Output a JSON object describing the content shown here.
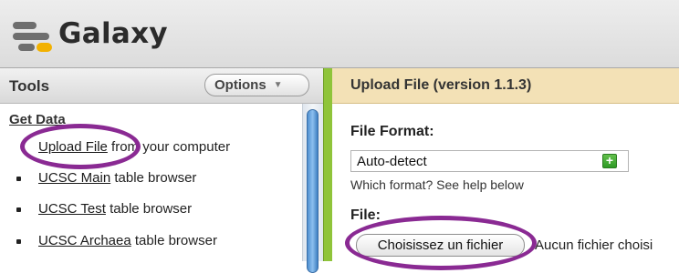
{
  "header": {
    "app_name": "Galaxy"
  },
  "tools_panel": {
    "title": "Tools",
    "options_label": "Options",
    "section_title": "Get Data",
    "items": [
      {
        "link": "Upload File",
        "text": "from your computer",
        "bullet": false
      },
      {
        "link": "UCSC Main",
        "text": "table browser",
        "bullet": true
      },
      {
        "link": "UCSC Test",
        "text": "table browser",
        "bullet": true
      },
      {
        "link": "UCSC Archaea",
        "text": "table browser",
        "bullet": true
      }
    ]
  },
  "form": {
    "title": "Upload File (version 1.1.3)",
    "file_format_label": "File Format:",
    "file_format_value": "Auto-detect",
    "file_format_help": "Which format? See help below",
    "file_label": "File:",
    "choose_file_label": "Choisissez un fichier",
    "no_file_text": "Aucun fichier choisi"
  },
  "colors": {
    "annotation": "#8a2a93",
    "divider": "#8fc43a",
    "form_header": "#f3e1b6",
    "scroll_thumb": "#4f8fd0"
  },
  "icons": [
    "galaxy-logo-icon",
    "chevron-down-icon",
    "add-icon"
  ]
}
